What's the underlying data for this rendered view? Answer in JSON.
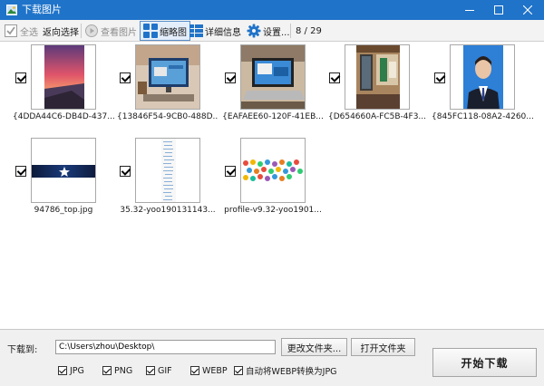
{
  "window": {
    "title": "下载图片"
  },
  "toolbar": {
    "select_all": "全选",
    "invert_select": "返向选择",
    "view_image": "查看图片",
    "thumbnails": "缩略图",
    "details": "详细信息",
    "settings": "设置...",
    "counter": "8 / 29"
  },
  "images": [
    {
      "caption": "{4DDA44C6-DB4D-437...",
      "checked": true
    },
    {
      "caption": "{13846F54-9CB0-488D...",
      "checked": true
    },
    {
      "caption": "{EAFAEE60-120F-41EB...",
      "checked": true
    },
    {
      "caption": "{D654660A-FC5B-4F3...",
      "checked": true
    },
    {
      "caption": "{845FC118-08A2-4260...",
      "checked": true
    },
    {
      "caption": "94786_top.jpg",
      "checked": true
    },
    {
      "caption": "35.32-yoo190131143...",
      "checked": true
    },
    {
      "caption": "profile-v9.32-yoo1901...",
      "checked": true
    }
  ],
  "bottom": {
    "download_label": "下载到:",
    "path_value": "C:\\Users\\zhou\\Desktop\\",
    "change_folder": "更改文件夹...",
    "open_folder": "打开文件夹",
    "start_download": "开始下载",
    "formats": [
      {
        "label": "JPG",
        "checked": true
      },
      {
        "label": "PNG",
        "checked": true
      },
      {
        "label": "GIF",
        "checked": true
      },
      {
        "label": "WEBP",
        "checked": true
      },
      {
        "label": "自动将WEBP转换为JPG",
        "checked": true
      }
    ]
  },
  "colors": {
    "titlebar": "#1f73c9",
    "accent": "#1f73c9",
    "background": "#ffffff",
    "panel": "#f0f0f0"
  }
}
